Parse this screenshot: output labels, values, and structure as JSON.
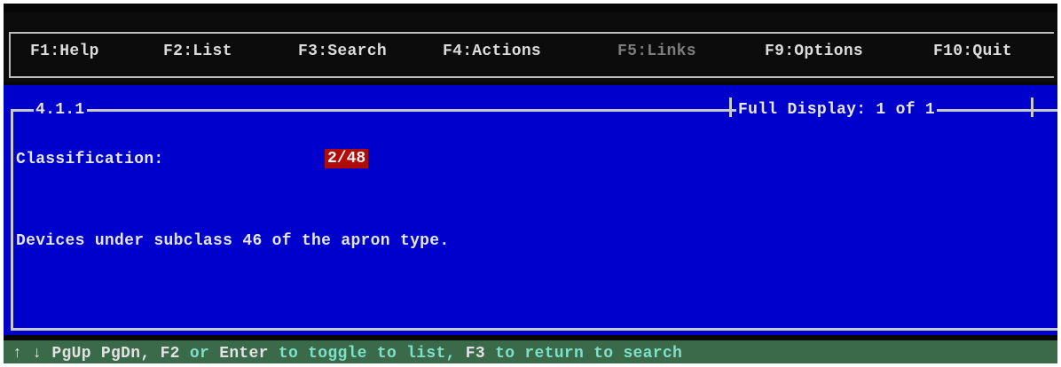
{
  "menu": {
    "items": [
      {
        "label": "F1:Help",
        "enabled": true
      },
      {
        "label": "F2:List",
        "enabled": true
      },
      {
        "label": "F3:Search",
        "enabled": true
      },
      {
        "label": "F4:Actions",
        "enabled": true
      },
      {
        "label": "F5:Links",
        "enabled": false
      },
      {
        "label": "F9:Options",
        "enabled": true
      },
      {
        "label": "F10:Quit",
        "enabled": true
      }
    ]
  },
  "panel": {
    "section_id": "4.1.1",
    "display_status": "Full Display: 1 of 1",
    "field_label": "Classification:",
    "field_value": "2/48",
    "description": "Devices under subclass 46 of the apron type."
  },
  "status": {
    "arrows": "↑ ↓",
    "pg_keys": "PgUp PgDn,",
    "f2_key": "F2",
    "or_text": "or",
    "enter_key": "Enter",
    "toggle_text": "to toggle to list,",
    "f3_key": "F3",
    "return_text": "to return to search"
  },
  "colors": {
    "panel_background": "#0000cc",
    "highlight_background": "#b00a0a",
    "status_background": "#3a6a4a",
    "status_hint_text": "#7fe0c8"
  }
}
